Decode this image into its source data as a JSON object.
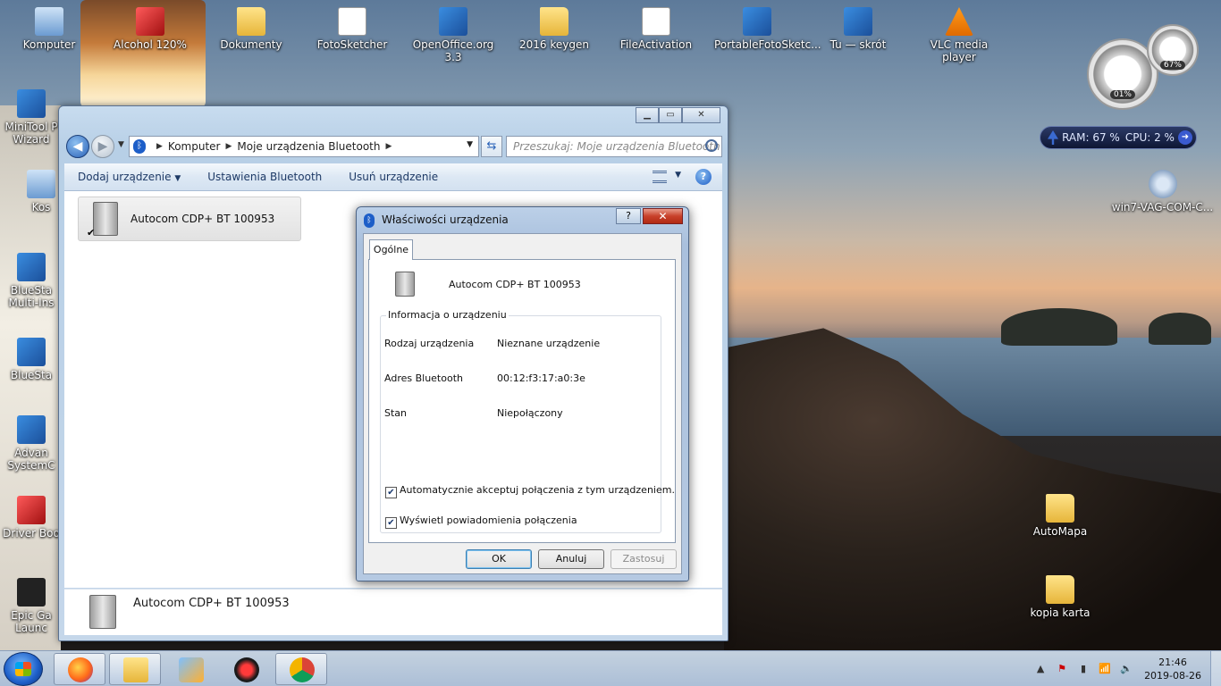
{
  "desktop": {
    "icons_top": [
      {
        "label": "Komputer",
        "kind": "pc"
      },
      {
        "label": "Alcohol 120%",
        "kind": "red"
      },
      {
        "label": "Dokumenty",
        "kind": "folder"
      },
      {
        "label": "FotoSketcher",
        "kind": "doc"
      },
      {
        "label": "OpenOffice.org 3.3",
        "kind": "app"
      },
      {
        "label": "2016 keygen",
        "kind": "folder"
      },
      {
        "label": "FileActivation",
        "kind": "doc"
      },
      {
        "label": "PortableFotoSketc...",
        "kind": "app"
      },
      {
        "label": "Tu — skrót",
        "kind": "app"
      },
      {
        "label": "VLC media player",
        "kind": "vlc"
      }
    ],
    "icons_left": [
      {
        "label": "MiniTool P\nWizard"
      },
      {
        "label": "Kos"
      },
      {
        "label": "BlueSta\nMulti-Ins"
      },
      {
        "label": "BlueSta"
      },
      {
        "label": "Advan\nSystemC"
      },
      {
        "label": "Driver Boo"
      },
      {
        "label": "Epic Ga\nLaunc"
      }
    ],
    "icons_right": [
      {
        "label": "win7-VAG-COM-C...",
        "kind": "gear"
      },
      {
        "label": "AutoMapa",
        "kind": "folder"
      },
      {
        "label": "kopia karta",
        "kind": "folder"
      }
    ]
  },
  "gadgets": {
    "cpu_gauge": "01%",
    "mem_gauge": "67%",
    "ram_label": "RAM: 67 %",
    "cpu_label": "CPU: 2 %"
  },
  "explorer": {
    "breadcrumb": [
      "Komputer",
      "Moje urządzenia Bluetooth"
    ],
    "search_placeholder": "Przeszukaj: Moje urządzenia Bluetooth",
    "toolbar": {
      "add_device": "Dodaj urządzenie",
      "bt_settings": "Ustawienia Bluetooth",
      "remove_device": "Usuń urządzenie"
    },
    "device_name": "Autocom CDP+ BT 100953",
    "details_name": "Autocom CDP+ BT 100953"
  },
  "dialog": {
    "title": "Właściwości urządzenia",
    "tab": "Ogólne",
    "device_name": "Autocom CDP+ BT 100953",
    "group_title": "Informacja o urządzeniu",
    "rows": [
      {
        "label": "Rodzaj urządzenia",
        "value": "Nieznane urządzenie"
      },
      {
        "label": "Adres Bluetooth",
        "value": "00:12:f3:17:a0:3e"
      },
      {
        "label": "Stan",
        "value": "Niepołączony"
      }
    ],
    "checkbox_auto": "Automatycznie akceptuj połączenia z tym urządzeniem.",
    "checkbox_notify": "Wyświetl powiadomienia połączenia",
    "ok": "OK",
    "cancel": "Anuluj",
    "apply": "Zastosuj"
  },
  "taskbar": {
    "time": "21:46",
    "date": "2019-08-26"
  }
}
